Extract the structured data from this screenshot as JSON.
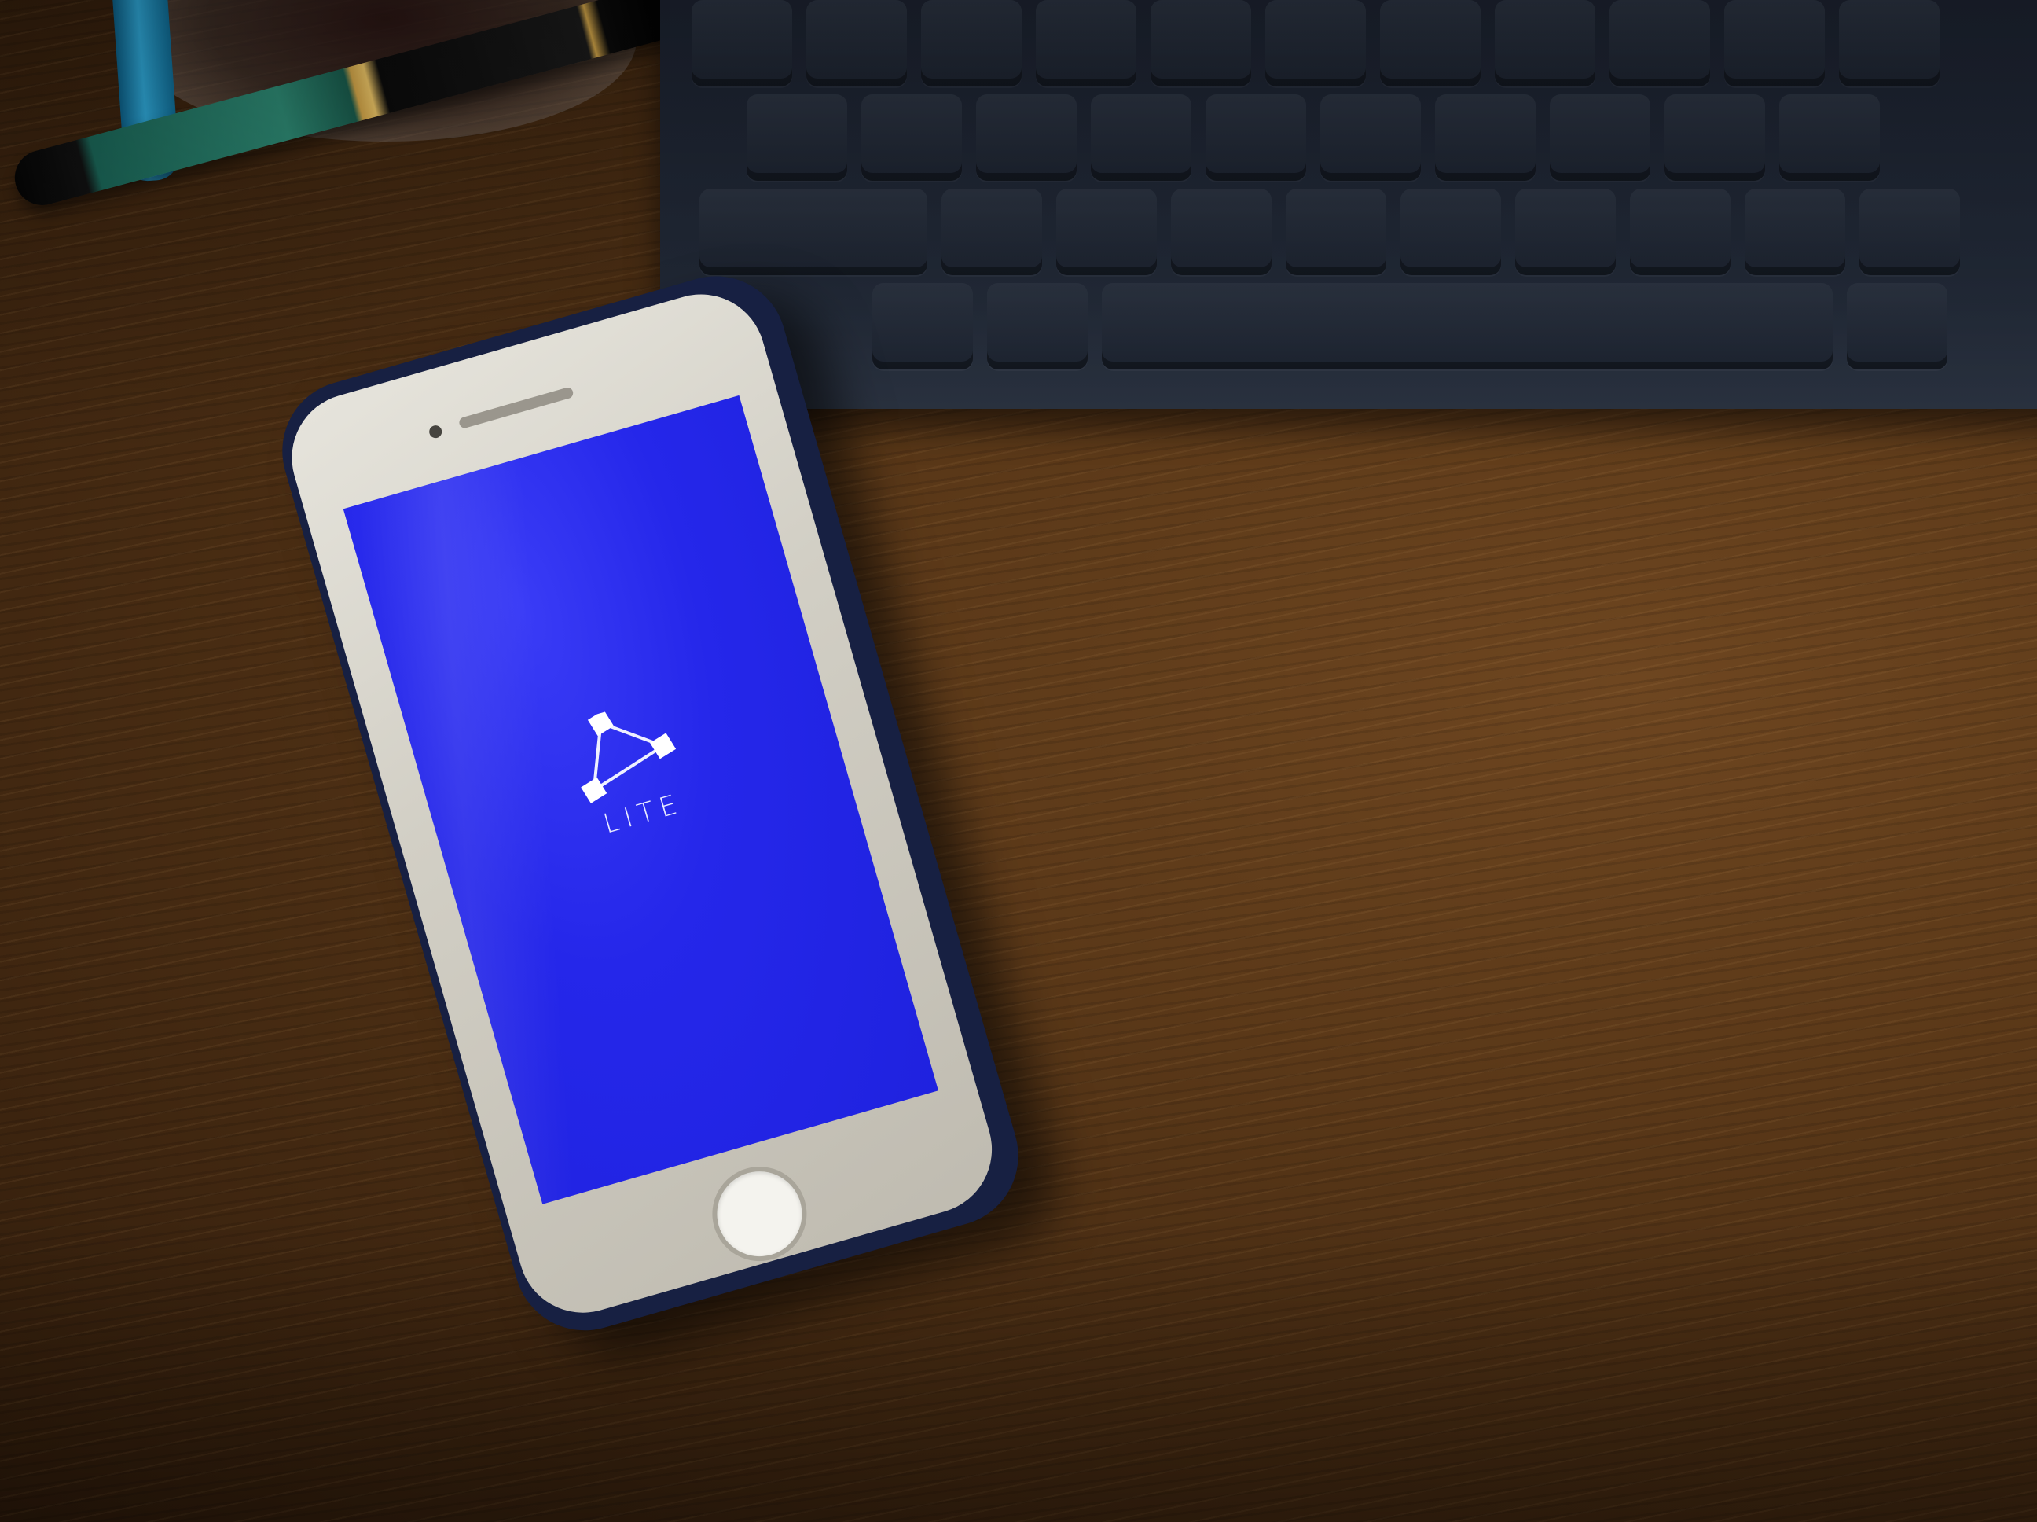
{
  "app": {
    "name_label": "LITE"
  },
  "colors": {
    "screen": "#2527ea",
    "phone": "#d2cfc5",
    "case": "#172042",
    "desk": "#5a3818",
    "keyboard": "#1d2431"
  },
  "icons": {
    "app_logo": "triangle-nodes-icon",
    "home": "home-button-icon"
  }
}
